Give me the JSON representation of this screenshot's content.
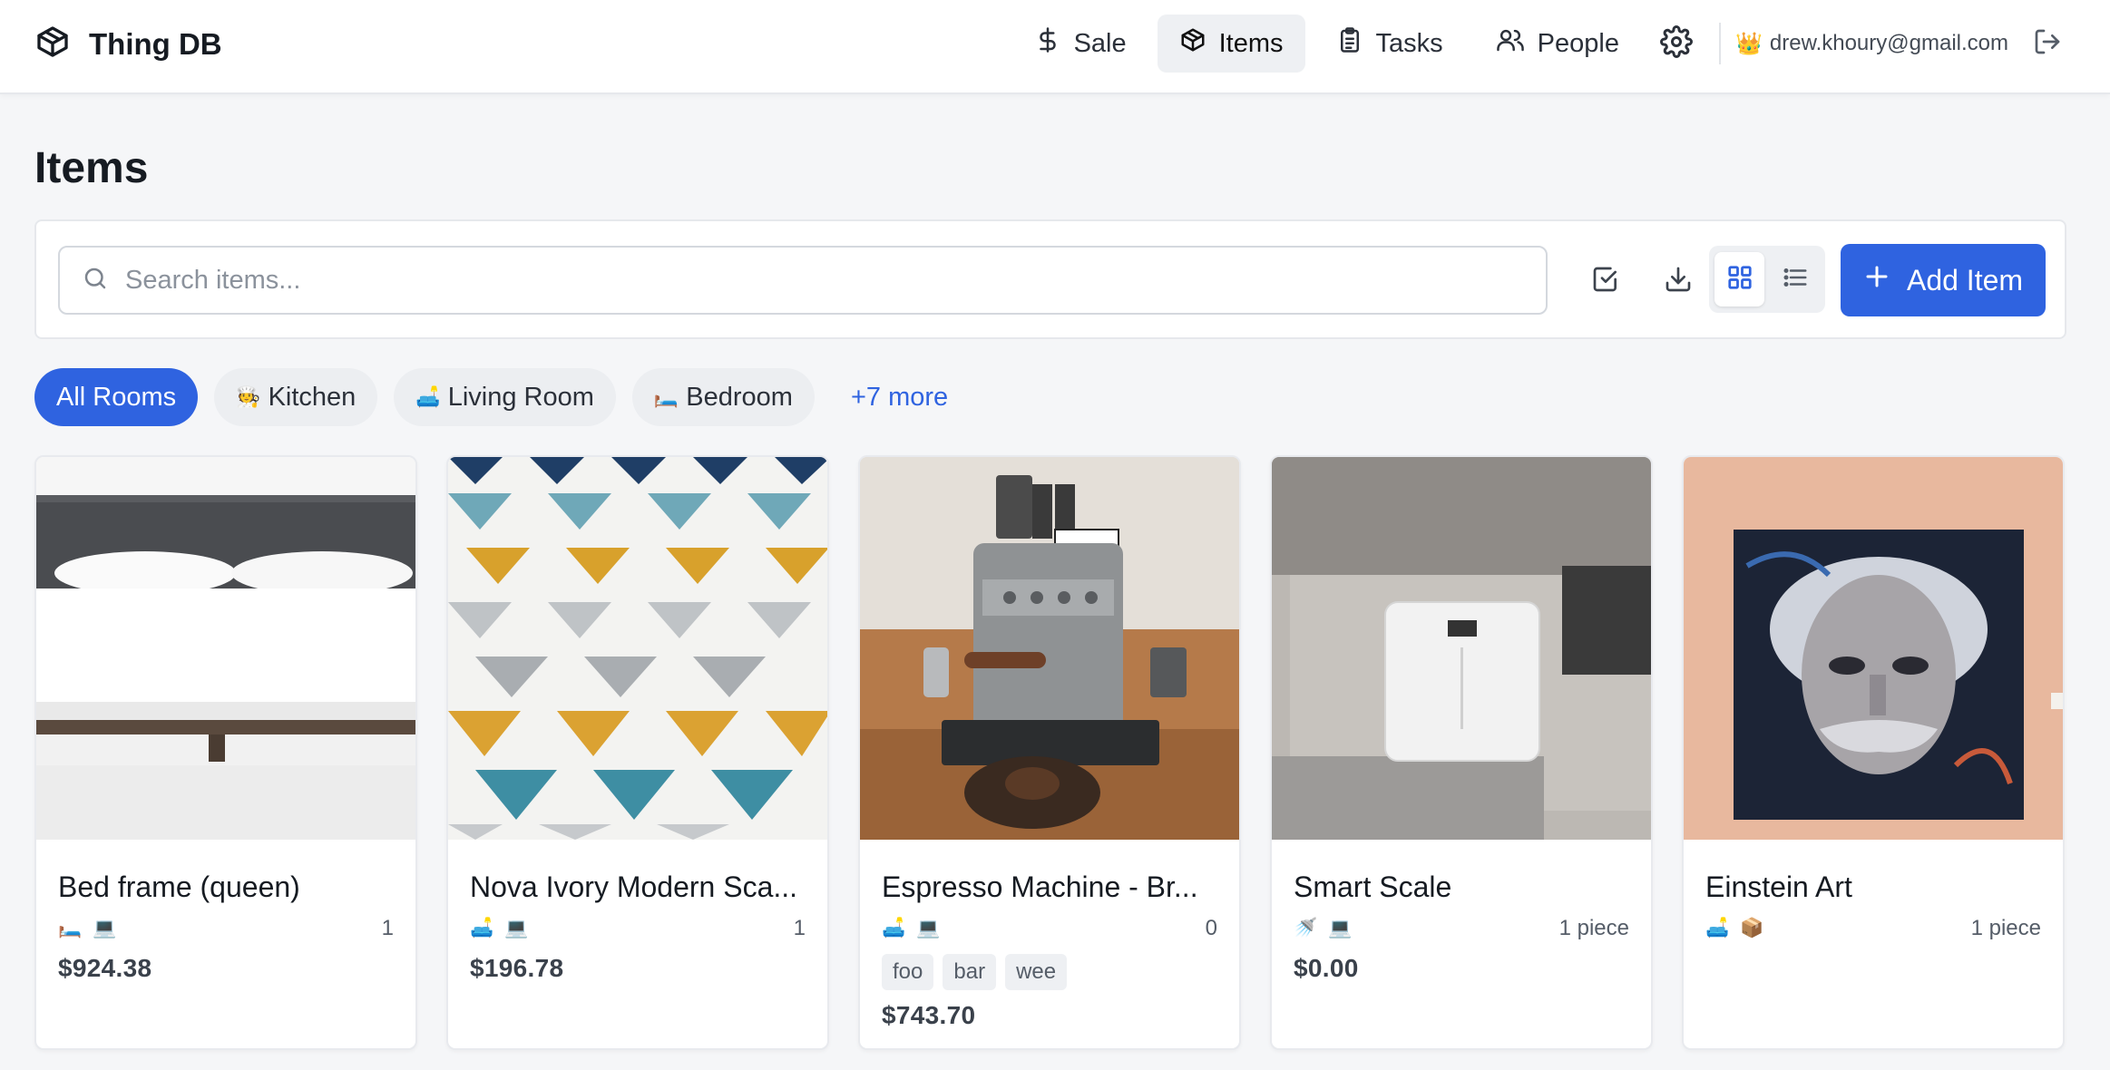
{
  "brand": {
    "name": "Thing DB",
    "icon": "box-icon"
  },
  "nav": {
    "items": [
      {
        "label": "Sale",
        "icon": "dollar-icon"
      },
      {
        "label": "Items",
        "icon": "box-icon"
      },
      {
        "label": "Tasks",
        "icon": "clipboard-icon"
      },
      {
        "label": "People",
        "icon": "users-icon"
      }
    ],
    "active": "Items",
    "settings_icon": "gear-icon",
    "user_badge": "👑",
    "user_email": "drew.khoury@gmail.com",
    "logout_icon": "logout-icon"
  },
  "page": {
    "title": "Items"
  },
  "toolbar": {
    "search_placeholder": "Search items...",
    "search_value": "",
    "select_icon": "checkbox-icon",
    "export_icon": "download-icon",
    "view_mode": "grid",
    "add_label": "Add Item",
    "accent": "#2f63e0"
  },
  "rooms": {
    "chips": [
      {
        "label": "All Rooms",
        "emoji": ""
      },
      {
        "label": "Kitchen",
        "emoji": "🧑‍🍳"
      },
      {
        "label": "Living Room",
        "emoji": "🛋️"
      },
      {
        "label": "Bedroom",
        "emoji": "🛏️"
      }
    ],
    "active": "All Rooms",
    "more_label": "+7 more"
  },
  "items": [
    {
      "title": "Bed frame (queen)",
      "icons": [
        "🛏️",
        "💻"
      ],
      "quantity": "1",
      "tags": [],
      "price": "$924.38",
      "photo": "bed-photo"
    },
    {
      "title": "Nova Ivory Modern Sca...",
      "icons": [
        "🛋️",
        "💻"
      ],
      "quantity": "1",
      "tags": [],
      "price": "$196.78",
      "photo": "rug-photo"
    },
    {
      "title": "Espresso Machine - Br...",
      "icons": [
        "🛋️",
        "💻"
      ],
      "quantity": "0",
      "tags": [
        "foo",
        "bar",
        "wee"
      ],
      "price": "$743.70",
      "photo": "espresso-photo"
    },
    {
      "title": "Smart Scale",
      "icons": [
        "🚿",
        "💻"
      ],
      "quantity": "1 piece",
      "tags": [],
      "price": "$0.00",
      "photo": "scale-photo"
    },
    {
      "title": "Einstein Art",
      "icons": [
        "🛋️",
        "📦"
      ],
      "quantity": "1 piece",
      "tags": [],
      "price": "",
      "photo": "portrait-photo"
    }
  ]
}
